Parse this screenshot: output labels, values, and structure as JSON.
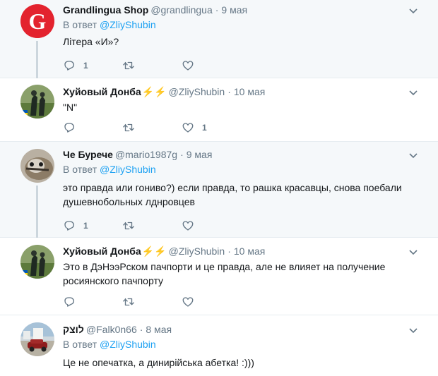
{
  "reply_prefix": "В ответ",
  "tweets": [
    {
      "name": "Grandlingua Shop",
      "emoji": "",
      "handle": "@grandlingua",
      "dot": "·",
      "time": "9 мая",
      "reply_to": "@ZliyShubin",
      "lines": [
        "Літера «И»?"
      ],
      "replies": "1",
      "retweets": "",
      "likes": ""
    },
    {
      "name": "Хуйовый Донба",
      "emoji": "⚡⚡",
      "handle": "@ZliyShubin",
      "dot": "·",
      "time": "10 мая",
      "reply_to": "",
      "lines": [
        "\"N\""
      ],
      "replies": "",
      "retweets": "",
      "likes": "1"
    },
    {
      "name": "Че Бурече",
      "emoji": "",
      "handle": "@mario1987g",
      "dot": "·",
      "time": "9 мая",
      "reply_to": "@ZliyShubin",
      "lines": [
        "это правда или гониво?) если правда, то рашка красавцы, снова поебали",
        "душевнобольных лднровцев"
      ],
      "replies": "1",
      "retweets": "",
      "likes": ""
    },
    {
      "name": "Хуйовый Донба",
      "emoji": "⚡⚡",
      "handle": "@ZliyShubin",
      "dot": "·",
      "time": "10 мая",
      "reply_to": "",
      "lines": [
        "Это в ДэНээРском пачпорти и це правда, але не влияет на получение",
        "росиянского пачпорту"
      ],
      "replies": "",
      "retweets": "",
      "likes": ""
    },
    {
      "name": "לוצק",
      "emoji": "",
      "handle": "@Falk0n66",
      "dot": "·",
      "time": "8 мая",
      "reply_to": "@ZliyShubin",
      "lines": [
        "Це не опечатка, а динирійська абетка! :)))"
      ],
      "replies": "",
      "retweets": "",
      "likes": ""
    }
  ],
  "colors": {
    "accent": "#1da1f2",
    "muted": "#657786",
    "highlight_bg": "#f5f8fa",
    "divider": "#e6ecf0",
    "thread_line": "#ccd6dd",
    "grandlingua_red": "#e3232e"
  },
  "icons": [
    "grandlingua-logo-icon",
    "lightning-icon",
    "reply-icon",
    "retweet-icon",
    "like-icon",
    "caret-down-icon"
  ]
}
